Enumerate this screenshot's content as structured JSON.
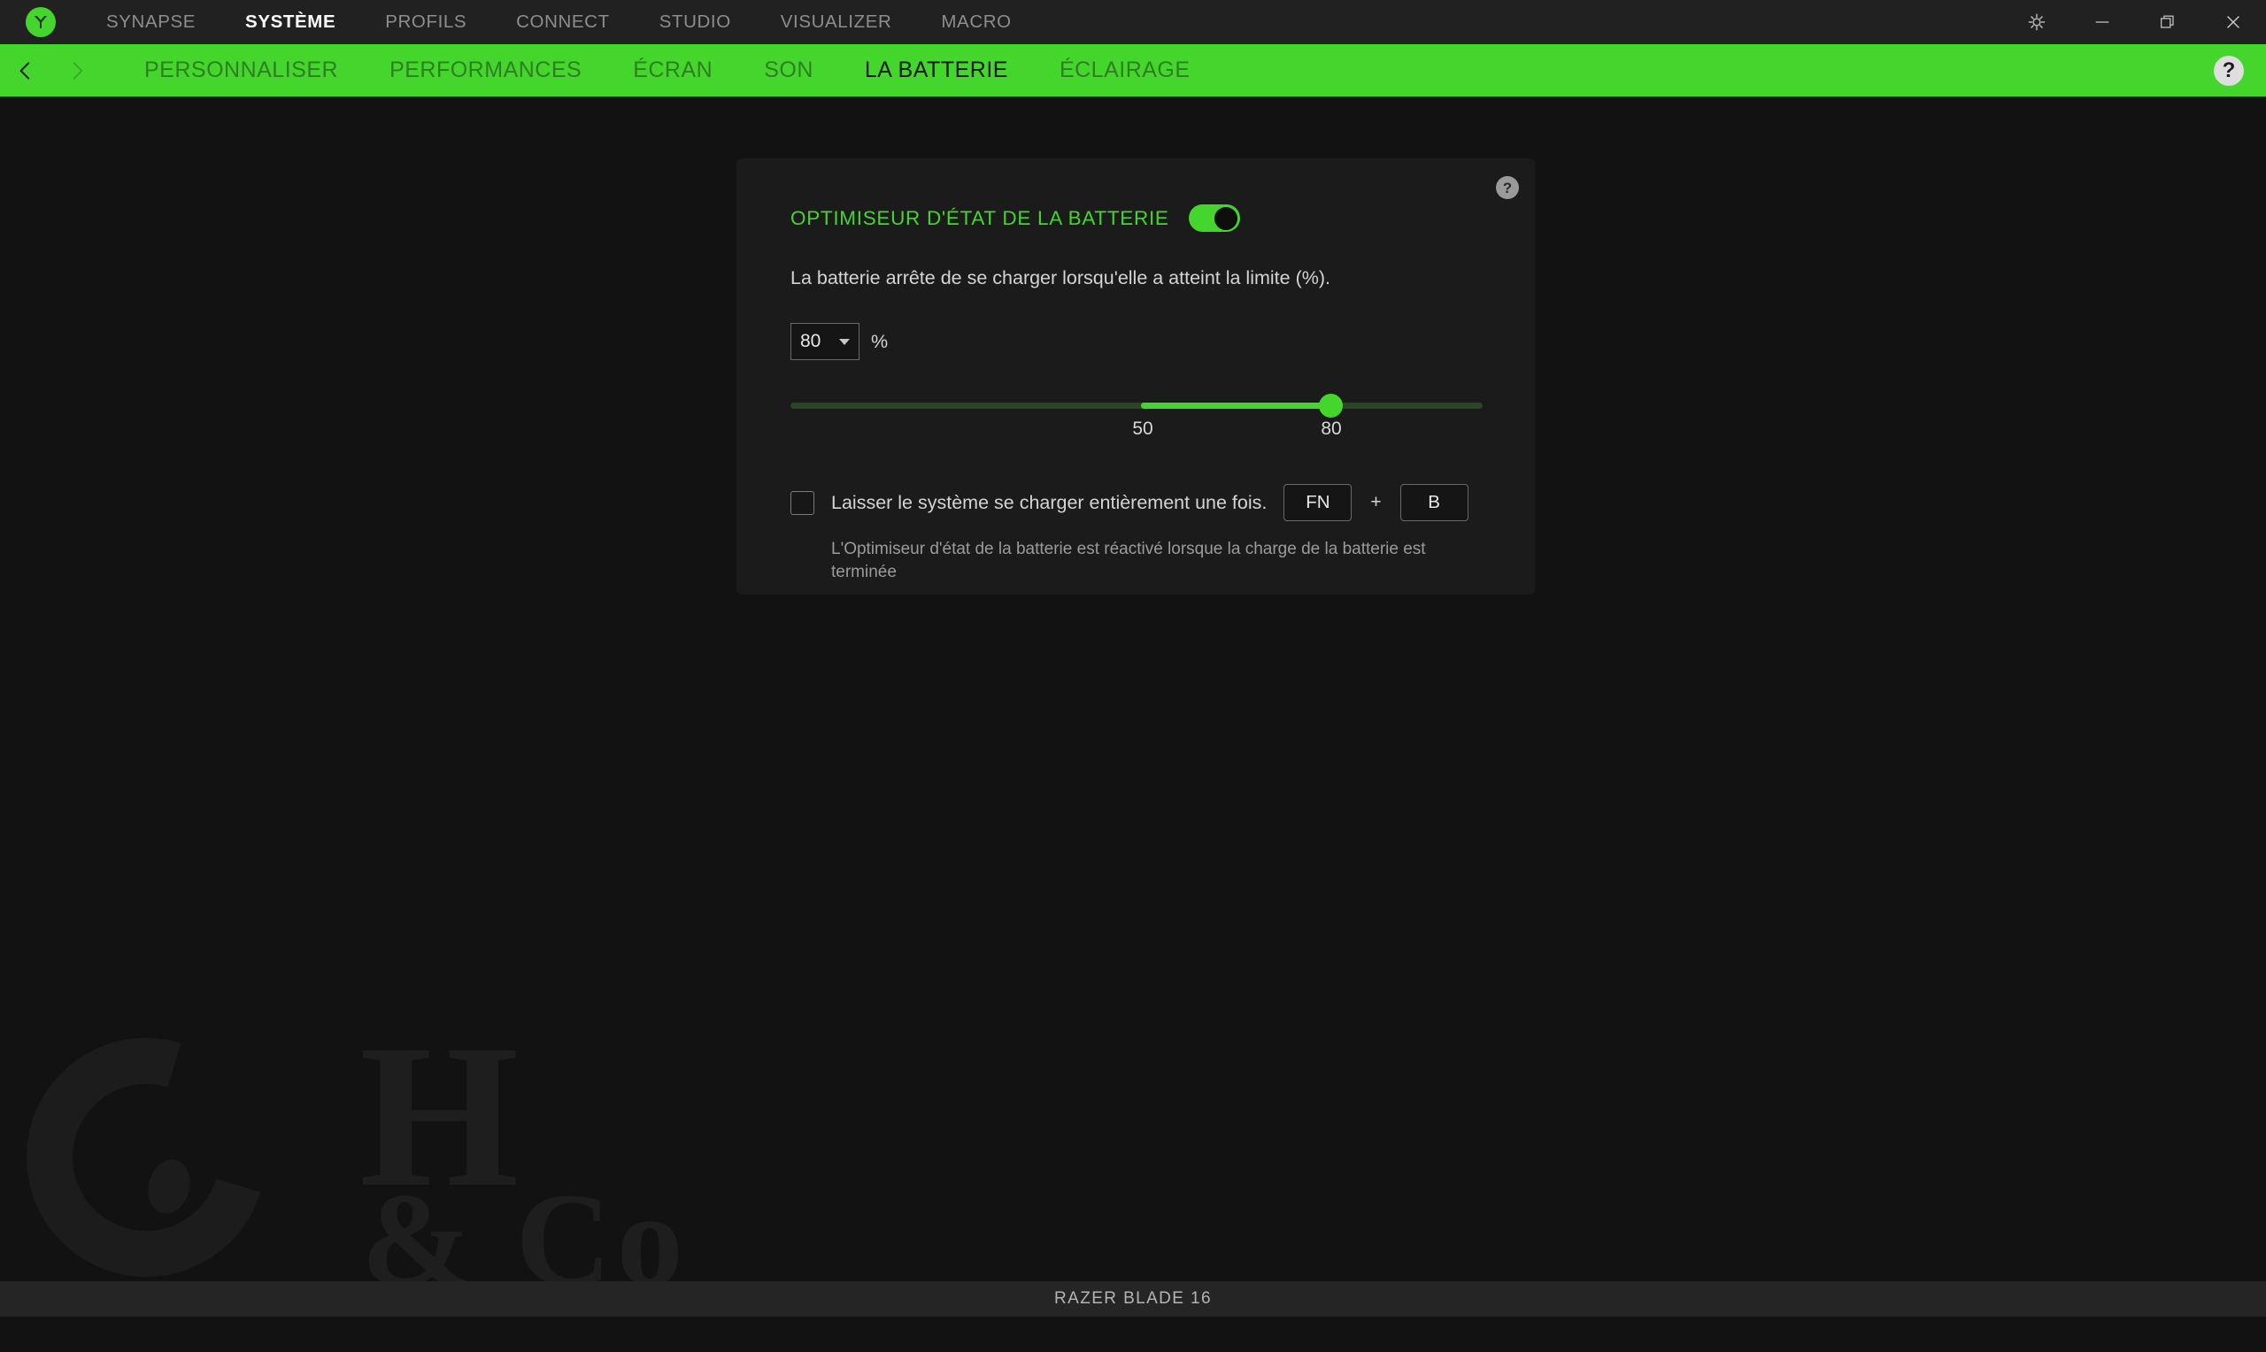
{
  "window": {
    "logo_icon": "razer-logo-icon",
    "controls": [
      {
        "name": "settings-gear-icon",
        "label": ""
      },
      {
        "name": "minimize-icon",
        "label": ""
      },
      {
        "name": "restore-icon",
        "label": ""
      },
      {
        "name": "close-icon",
        "label": ""
      }
    ]
  },
  "top_tabs": [
    {
      "label": "SYNAPSE",
      "active": false
    },
    {
      "label": "SYSTÈME",
      "active": true
    },
    {
      "label": "PROFILS",
      "active": false
    },
    {
      "label": "CONNECT",
      "active": false
    },
    {
      "label": "STUDIO",
      "active": false
    },
    {
      "label": "VISUALIZER",
      "active": false
    },
    {
      "label": "MACRO",
      "active": false
    }
  ],
  "sub_tabs": [
    {
      "label": "PERSONNALISER",
      "active": false
    },
    {
      "label": "PERFORMANCES",
      "active": false
    },
    {
      "label": "ÉCRAN",
      "active": false
    },
    {
      "label": "SON",
      "active": false
    },
    {
      "label": "LA BATTERIE",
      "active": true
    },
    {
      "label": "ÉCLAIRAGE",
      "active": false
    }
  ],
  "nav": {
    "back_icon": "chevron-left-icon",
    "forward_icon": "chevron-right-icon",
    "help_label": "?"
  },
  "card": {
    "help_label": "?",
    "section_title": "OPTIMISEUR D'ÉTAT DE LA BATTERIE",
    "toggle_state": "on",
    "description": "La batterie arrête de se charger lorsqu'elle a atteint la limite (%).",
    "select_value": "80",
    "percent_symbol": "%",
    "slider": {
      "value": 80,
      "min": 50,
      "max": 100,
      "tick_min_label": "50",
      "tick_value_label": "80"
    },
    "checkbox": {
      "checked": false,
      "label": "Laisser le système se charger entièrement une fois."
    },
    "shortcut": {
      "key1": "FN",
      "plus": "+",
      "key2": "B"
    },
    "note": "L'Optimiseur d'état de la batterie est réactivé lorsque la charge de la batterie est terminée"
  },
  "watermark": {
    "letter": "H",
    "suffix": "& Co"
  },
  "status": {
    "device": "RAZER BLADE 16"
  },
  "colors": {
    "razer_green": "#44d62c",
    "page_bg": "#121212",
    "card_bg": "#1b1b1b",
    "titlebar_bg": "#212121",
    "statusbar_bg": "#252525"
  }
}
